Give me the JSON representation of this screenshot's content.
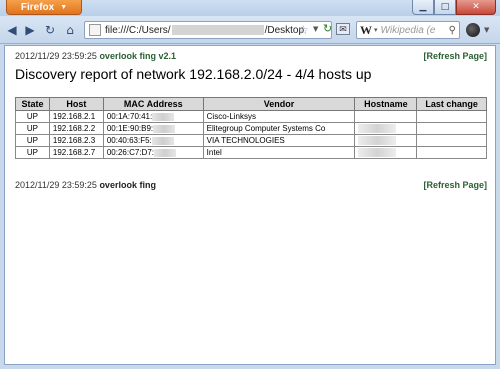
{
  "browser": {
    "menu_button": "Firefox",
    "url_prefix": "file:///C:/Users/",
    "url_suffix": "/Desktop",
    "search_engine": "W",
    "search_placeholder": "Wikipedia (e"
  },
  "report": {
    "timestamp": "2012/11/29 23:59:25",
    "app_version": "overlook fing v2.1",
    "refresh_label": "[Refresh Page]",
    "title": "Discovery report of network  192.168.2.0/24 - 4/4 hosts up",
    "footer_timestamp": "2012/11/29 23:59:25",
    "footer_app": "overlook fing",
    "footer_refresh_label": "[Refresh Page]"
  },
  "table": {
    "headers": [
      "State",
      "Host",
      "MAC Address",
      "Vendor",
      "Hostname",
      "Last change"
    ],
    "rows": [
      {
        "state": "UP",
        "host": "192.168.2.1",
        "mac": "00:1A:70:41:",
        "vendor": "Cisco-Linksys",
        "hostname": "",
        "last_change": ""
      },
      {
        "state": "UP",
        "host": "192.168.2.2",
        "mac": "00:1E:90:B9:",
        "vendor": "Elitegroup Computer Systems Co",
        "hostname": "",
        "last_change": ""
      },
      {
        "state": "UP",
        "host": "192.168.2.3",
        "mac": "00:40:63:F5:",
        "vendor": "VIA TECHNOLOGIES",
        "hostname": "",
        "last_change": ""
      },
      {
        "state": "UP",
        "host": "192.168.2.7",
        "mac": "00:26:C7:D7:",
        "vendor": "Intel",
        "hostname": "",
        "last_change": ""
      }
    ]
  }
}
